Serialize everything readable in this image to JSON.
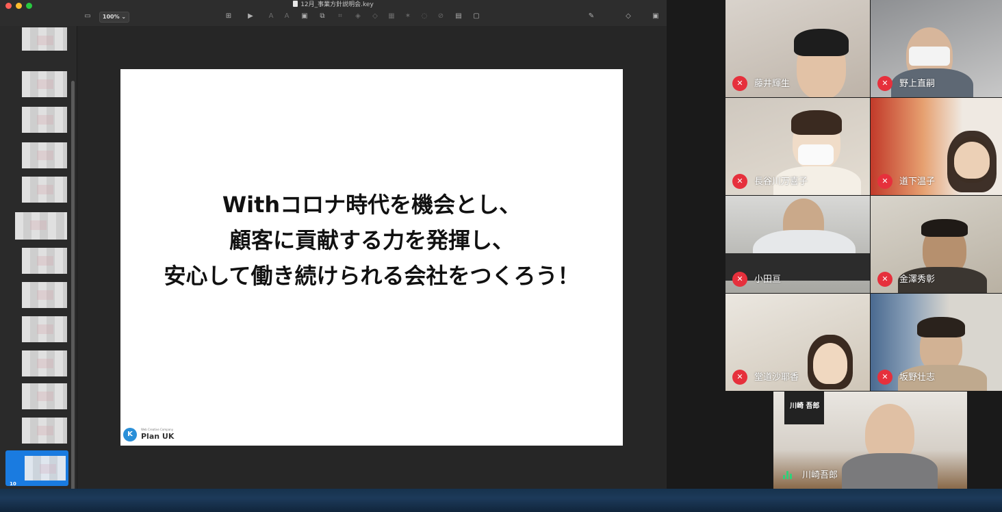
{
  "keynote": {
    "window_title": "12月_事業方針説明会.key",
    "zoom_level": "100% ⌄",
    "slide_number": "10",
    "slide_text": {
      "line1": "Withコロナ時代を機会とし、",
      "line2": "顧客に貢献する力を発揮し、",
      "line3": "安心して働き続けられる会社をつくろう！"
    },
    "logo": {
      "tagline": "Web Creative Company",
      "name": "Plan UK",
      "mark": "K"
    }
  },
  "zoom": {
    "participants": [
      {
        "name": "藤井輝生",
        "muted": true
      },
      {
        "name": "野上直嗣",
        "muted": true
      },
      {
        "name": "長谷川万喜子",
        "muted": true
      },
      {
        "name": "道下温子",
        "muted": true
      },
      {
        "name": "小田亘",
        "muted": true
      },
      {
        "name": "金澤秀彰",
        "muted": true
      },
      {
        "name": "堂道沙耶香",
        "muted": true
      },
      {
        "name": "坂野壮志",
        "muted": true
      }
    ],
    "active_speaker": {
      "label": "川崎 吾郎",
      "name": "川崎吾郎"
    },
    "colors": {
      "mute_badge": "#e6303c",
      "speaking": "#2fd17a"
    }
  }
}
